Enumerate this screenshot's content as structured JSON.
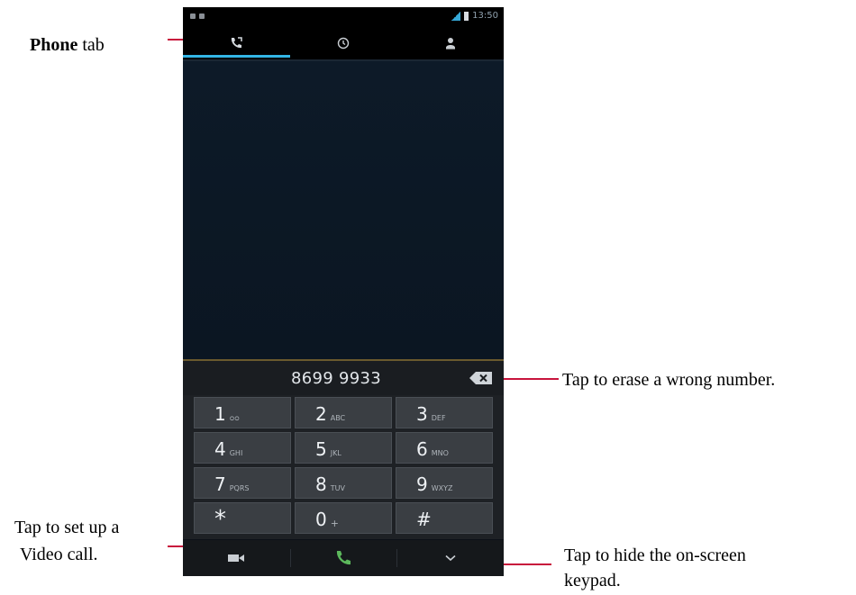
{
  "status_bar": {
    "time": "13:50"
  },
  "tabs": [
    {
      "icon": "phone-icon",
      "active": true
    },
    {
      "icon": "recent-calls-clock-icon",
      "active": false
    },
    {
      "icon": "contacts-person-icon",
      "active": false
    }
  ],
  "dialed_number": "8699 9933",
  "keypad": [
    {
      "digit": "1",
      "letters": "ᴑᴑ"
    },
    {
      "digit": "2",
      "letters": "ABC"
    },
    {
      "digit": "3",
      "letters": "DEF"
    },
    {
      "digit": "4",
      "letters": "GHI"
    },
    {
      "digit": "5",
      "letters": "JKL"
    },
    {
      "digit": "6",
      "letters": "MNO"
    },
    {
      "digit": "7",
      "letters": "PQRS"
    },
    {
      "digit": "8",
      "letters": "TUV"
    },
    {
      "digit": "9",
      "letters": "WXYZ"
    },
    {
      "digit": "*",
      "letters": ""
    },
    {
      "digit": "0",
      "letters": "+"
    },
    {
      "digit": "#",
      "letters": ""
    }
  ],
  "actions": [
    "video-call-icon",
    "call-icon",
    "hide-keypad-chevron-icon"
  ],
  "annotations": {
    "phone_tab_bold": "Phone",
    "phone_tab_rest": " tab",
    "erase": "Tap to erase a wrong number.",
    "video_line1": "Tap to set up a",
    "video_line2": "Video call.",
    "hide_line1": "Tap to hide the on-screen",
    "hide_line2": "keypad."
  },
  "colors": {
    "accent": "#33b5e5",
    "call_green": "#5cb85c",
    "callout_line": "#c8143c"
  }
}
